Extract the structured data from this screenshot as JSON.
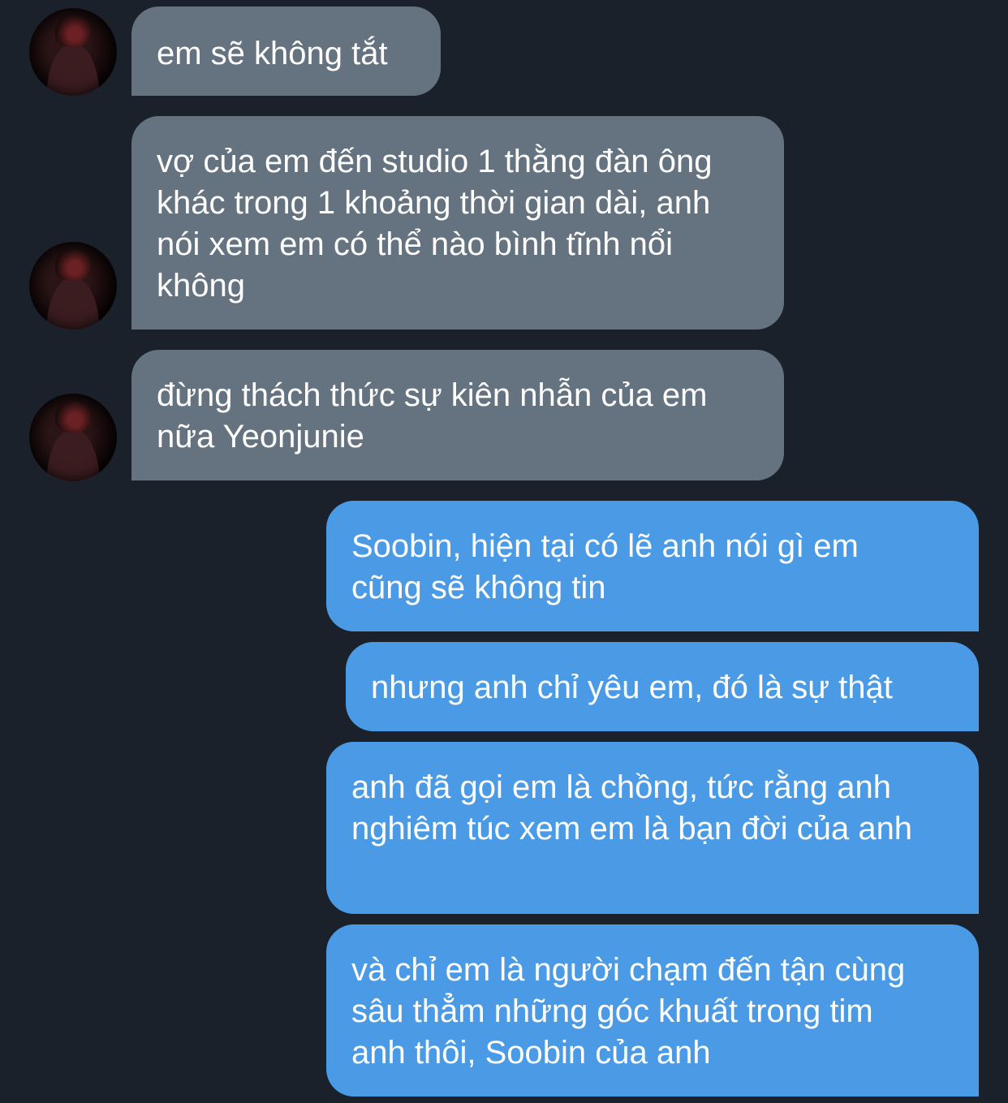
{
  "conversation": {
    "incoming": [
      {
        "text": "em sẽ không tắt"
      },
      {
        "text": "vợ của em đến studio 1 thằng đàn ông khác trong 1 khoảng thời gian dài, anh nói xem em có thể nào bình tĩnh nổi không"
      },
      {
        "text": "đừng thách thức sự kiên nhẫn của em nữa Yeonjunie"
      }
    ],
    "outgoing": [
      {
        "text": "Soobin, hiện tại có lẽ anh nói gì em cũng sẽ không tin"
      },
      {
        "text": "nhưng anh chỉ yêu em, đó là sự thật"
      },
      {
        "text": "anh đã gọi em là chồng, tức rằng anh nghiêm túc xem em là bạn đời của anh"
      },
      {
        "text": "và chỉ em là người chạm đến tận cùng sâu thẳm những góc khuất trong tim anh thôi, Soobin của anh"
      }
    ]
  },
  "colors": {
    "background": "#1a212b",
    "incoming_bubble": "#65727f",
    "outgoing_bubble": "#4a9ae5",
    "text": "#ffffff"
  }
}
